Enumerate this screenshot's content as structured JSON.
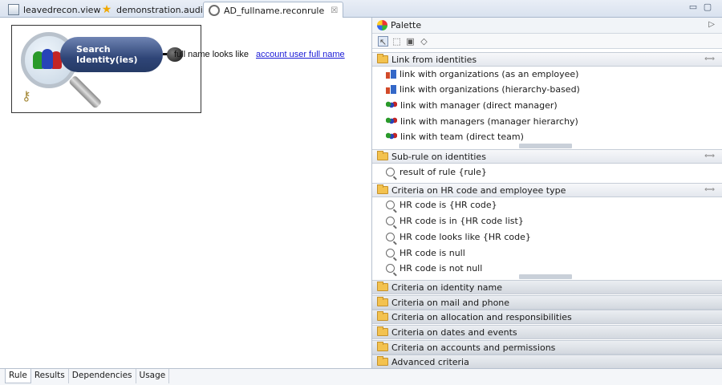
{
  "tabs": [
    {
      "label": "leavedrecon.view",
      "icon": "view-file-icon"
    },
    {
      "label": "demonstration.audit",
      "icon": "star-icon"
    },
    {
      "label": "AD_fullname.reconrule",
      "icon": "search-icon",
      "active": true,
      "close": "☒"
    }
  ],
  "window_controls": {
    "minimize": "▭",
    "maximize": "▢"
  },
  "editor": {
    "search_node": {
      "line1": "Search",
      "line2": "Identity(ies)"
    },
    "criteria": {
      "text": "full name looks like",
      "link": "account user full name"
    }
  },
  "palette": {
    "title": "Palette",
    "collapse": "▷",
    "tools": [
      "↖",
      "⬚",
      "▣",
      "◇"
    ],
    "drawers": [
      {
        "label": "Link from identities",
        "open": true,
        "items": [
          {
            "label": "link with organizations (as an employee)",
            "icon": "org"
          },
          {
            "label": "link with organizations (hierarchy-based)",
            "icon": "org"
          },
          {
            "label": "link with manager (direct manager)",
            "icon": "people"
          },
          {
            "label": "link with managers (manager hierarchy)",
            "icon": "people"
          },
          {
            "label": "link with team (direct team)",
            "icon": "people"
          }
        ]
      },
      {
        "label": "Sub-rule on identities",
        "open": true,
        "items": [
          {
            "label": "result of rule {rule}",
            "icon": "search"
          }
        ]
      },
      {
        "label": "Criteria on HR code and employee type",
        "open": true,
        "items": [
          {
            "label": "HR code is {HR code}",
            "icon": "search"
          },
          {
            "label": "HR code is in {HR code list}",
            "icon": "search"
          },
          {
            "label": "HR code looks like {HR code}",
            "icon": "search"
          },
          {
            "label": "HR code is null",
            "icon": "search"
          },
          {
            "label": "HR code is not null",
            "icon": "search"
          }
        ]
      },
      {
        "label": "Criteria on identity name",
        "open": false
      },
      {
        "label": "Criteria on mail and phone",
        "open": false
      },
      {
        "label": "Criteria on allocation and responsibilities",
        "open": false
      },
      {
        "label": "Criteria on dates and events",
        "open": false
      },
      {
        "label": "Criteria on accounts and permissions",
        "open": false
      },
      {
        "label": "Advanced criteria",
        "open": false
      }
    ]
  },
  "bottom_tabs": [
    {
      "label": "Rule",
      "active": true
    },
    {
      "label": "Results"
    },
    {
      "label": "Dependencies"
    },
    {
      "label": "Usage"
    }
  ]
}
